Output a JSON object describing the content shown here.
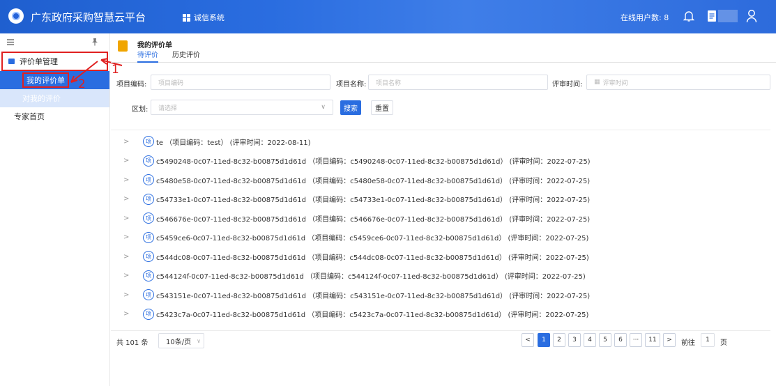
{
  "header": {
    "app_title": "广东政府采购智慧云平台",
    "system_label": "诚信系统",
    "online_users": "在线用户数: 8"
  },
  "sidebar": {
    "group_label": "评价单管理",
    "items": [
      {
        "label": "我的评价单",
        "active": true
      },
      {
        "label": "对我的评价",
        "active": false
      }
    ],
    "home_label": "专家首页"
  },
  "annotations": {
    "one": "1",
    "two": "2"
  },
  "page": {
    "title": "我的评价单",
    "tabs": [
      "待评价",
      "历史评价"
    ]
  },
  "filters": {
    "project_code_label": "项目编码:",
    "project_code_placeholder": "项目编码",
    "project_name_label": "项目名称:",
    "project_name_placeholder": "项目名称",
    "review_time_label": "评审时间:",
    "review_time_placeholder": "评审时间",
    "region_label": "区划:",
    "region_placeholder": "请选择",
    "search_label": "搜索",
    "reset_label": "重置"
  },
  "list": {
    "badge": "项",
    "rows": [
      "te （项目编码：test） (评审时间：2022-08-11)",
      "c5490248-0c07-11ed-8c32-b00875d1d61d （项目编码：c5490248-0c07-11ed-8c32-b00875d1d61d） (评审时间：2022-07-25)",
      "c5480e58-0c07-11ed-8c32-b00875d1d61d （项目编码：c5480e58-0c07-11ed-8c32-b00875d1d61d） (评审时间：2022-07-25)",
      "c54733e1-0c07-11ed-8c32-b00875d1d61d （项目编码：c54733e1-0c07-11ed-8c32-b00875d1d61d） (评审时间：2022-07-25)",
      "c546676e-0c07-11ed-8c32-b00875d1d61d （项目编码：c546676e-0c07-11ed-8c32-b00875d1d61d） (评审时间：2022-07-25)",
      "c5459ce6-0c07-11ed-8c32-b00875d1d61d （项目编码：c5459ce6-0c07-11ed-8c32-b00875d1d61d） (评审时间：2022-07-25)",
      "c544dc08-0c07-11ed-8c32-b00875d1d61d （项目编码：c544dc08-0c07-11ed-8c32-b00875d1d61d） (评审时间：2022-07-25)",
      "c544124f-0c07-11ed-8c32-b00875d1d61d （项目编码：c544124f-0c07-11ed-8c32-b00875d1d61d） (评审时间：2022-07-25)",
      "c543151e-0c07-11ed-8c32-b00875d1d61d （项目编码：c543151e-0c07-11ed-8c32-b00875d1d61d） (评审时间：2022-07-25)",
      "c5423c7a-0c07-11ed-8c32-b00875d1d61d （项目编码：c5423c7a-0c07-11ed-8c32-b00875d1d61d） (评审时间：2022-07-25)"
    ]
  },
  "pagination": {
    "total": "共 101 条",
    "page_size": "10条/页",
    "prev": "<",
    "next": ">",
    "pages": [
      "1",
      "2",
      "3",
      "4",
      "5",
      "6",
      "···",
      "11"
    ],
    "goto_label": "前往",
    "goto_value": "1",
    "page_unit": "页"
  },
  "colors": {
    "accent": "#2a6de0",
    "annotation": "#e02020"
  }
}
